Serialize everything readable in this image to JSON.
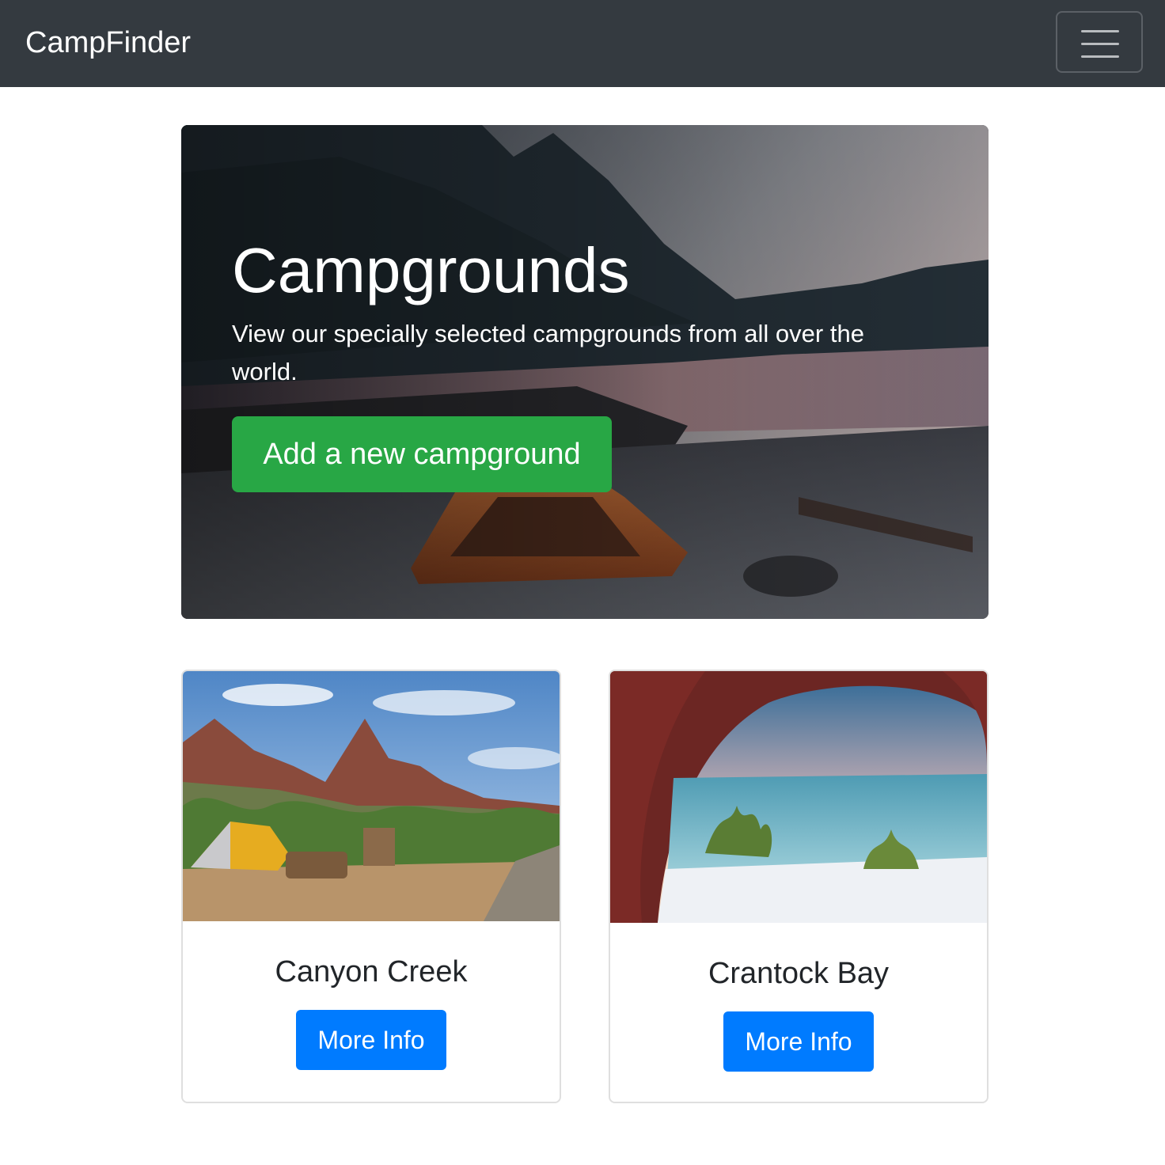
{
  "navbar": {
    "brand": "CampFinder",
    "toggler_icon": "hamburger-menu-icon"
  },
  "jumbotron": {
    "title": "Campgrounds",
    "lead": "View our specially selected campgrounds from all over the world.",
    "add_button_label": "Add a new campground",
    "background_image": "mountain-lake-tent-photo"
  },
  "campgrounds": [
    {
      "name": "Canyon Creek",
      "button_label": "More Info",
      "image": "canyon-tent-photo"
    },
    {
      "name": "Crantock Bay",
      "button_label": "More Info",
      "image": "beach-from-tent-photo"
    }
  ],
  "colors": {
    "navbar_bg": "#343a40",
    "success": "#28a745",
    "primary": "#007bff"
  }
}
